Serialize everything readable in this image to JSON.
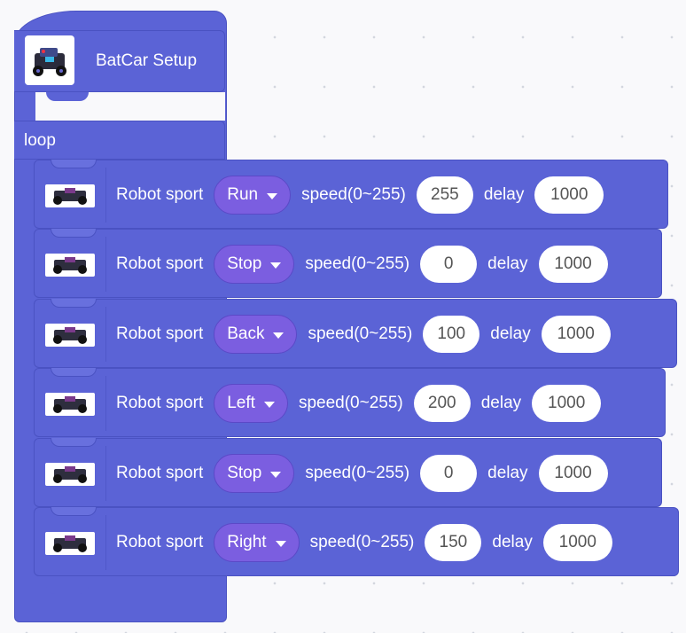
{
  "setup": {
    "title": "BatCar Setup",
    "icon": "robot-car-icon"
  },
  "loop": {
    "label": "loop"
  },
  "colors": {
    "block": "#5b63d6",
    "dropdown": "#7b5ee0",
    "field": "#ffffff"
  },
  "statements": [
    {
      "label": "Robot sport",
      "mode": "Run",
      "speed_label": "speed(0~255)",
      "speed": "255",
      "delay_label": "delay",
      "delay": "1000"
    },
    {
      "label": "Robot sport",
      "mode": "Stop",
      "speed_label": "speed(0~255)",
      "speed": "0",
      "delay_label": "delay",
      "delay": "1000"
    },
    {
      "label": "Robot sport",
      "mode": "Back",
      "speed_label": "speed(0~255)",
      "speed": "100",
      "delay_label": "delay",
      "delay": "1000"
    },
    {
      "label": "Robot sport",
      "mode": "Left",
      "speed_label": "speed(0~255)",
      "speed": "200",
      "delay_label": "delay",
      "delay": "1000"
    },
    {
      "label": "Robot sport",
      "mode": "Stop",
      "speed_label": "speed(0~255)",
      "speed": "0",
      "delay_label": "delay",
      "delay": "1000"
    },
    {
      "label": "Robot sport",
      "mode": "Right",
      "speed_label": "speed(0~255)",
      "speed": "150",
      "delay_label": "delay",
      "delay": "1000"
    }
  ]
}
